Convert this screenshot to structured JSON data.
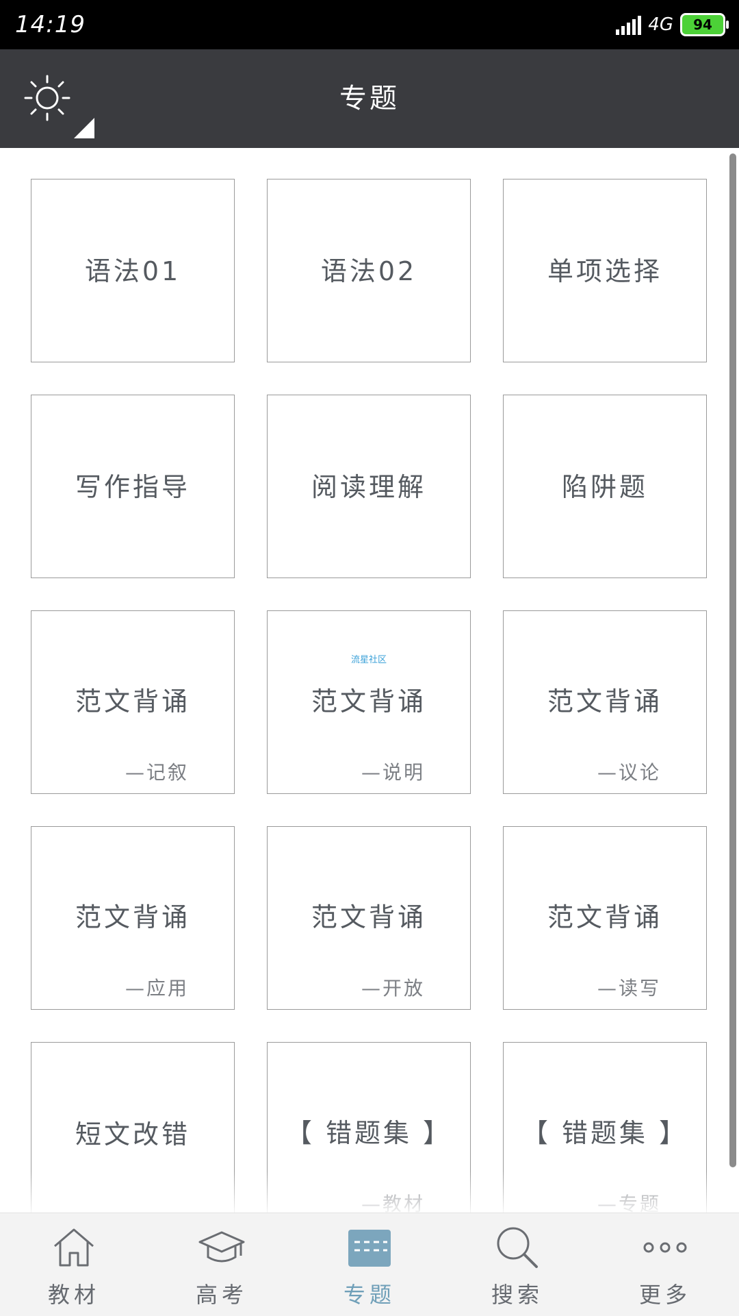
{
  "status_bar": {
    "time": "14:19",
    "network": "4G",
    "battery": "94"
  },
  "header": {
    "title": "专题",
    "theme_icon": "sun-icon"
  },
  "tiles": [
    {
      "label": "语法01",
      "sub": ""
    },
    {
      "label": "语法02",
      "sub": ""
    },
    {
      "label": "单项选择",
      "sub": ""
    },
    {
      "label": "写作指导",
      "sub": ""
    },
    {
      "label": "阅读理解",
      "sub": ""
    },
    {
      "label": "陷阱题",
      "sub": ""
    },
    {
      "label": "范文背诵",
      "sub": "—记叙"
    },
    {
      "label": "范文背诵",
      "sub": "—说明"
    },
    {
      "label": "范文背诵",
      "sub": "—议论"
    },
    {
      "label": "范文背诵",
      "sub": "—应用"
    },
    {
      "label": "范文背诵",
      "sub": "—开放"
    },
    {
      "label": "范文背诵",
      "sub": "—读写"
    },
    {
      "label": "短文改错",
      "sub": ""
    },
    {
      "label": "【 错题集 】",
      "sub": "—教材"
    },
    {
      "label": "【 错题集 】",
      "sub": "—专题"
    }
  ],
  "watermark": "流星社区",
  "bottom_nav": [
    {
      "label": "教材",
      "icon": "home-icon",
      "active": false
    },
    {
      "label": "高考",
      "icon": "graduation-cap-icon",
      "active": false
    },
    {
      "label": "专题",
      "icon": "topic-card-icon",
      "active": true
    },
    {
      "label": "搜索",
      "icon": "search-icon",
      "active": false
    },
    {
      "label": "更多",
      "icon": "more-icon",
      "active": false
    }
  ],
  "colors": {
    "header_bg": "#3a3b3f",
    "accent": "#6f9fb8",
    "tile_border": "#9a9a9a",
    "tile_text": "#555a60"
  }
}
